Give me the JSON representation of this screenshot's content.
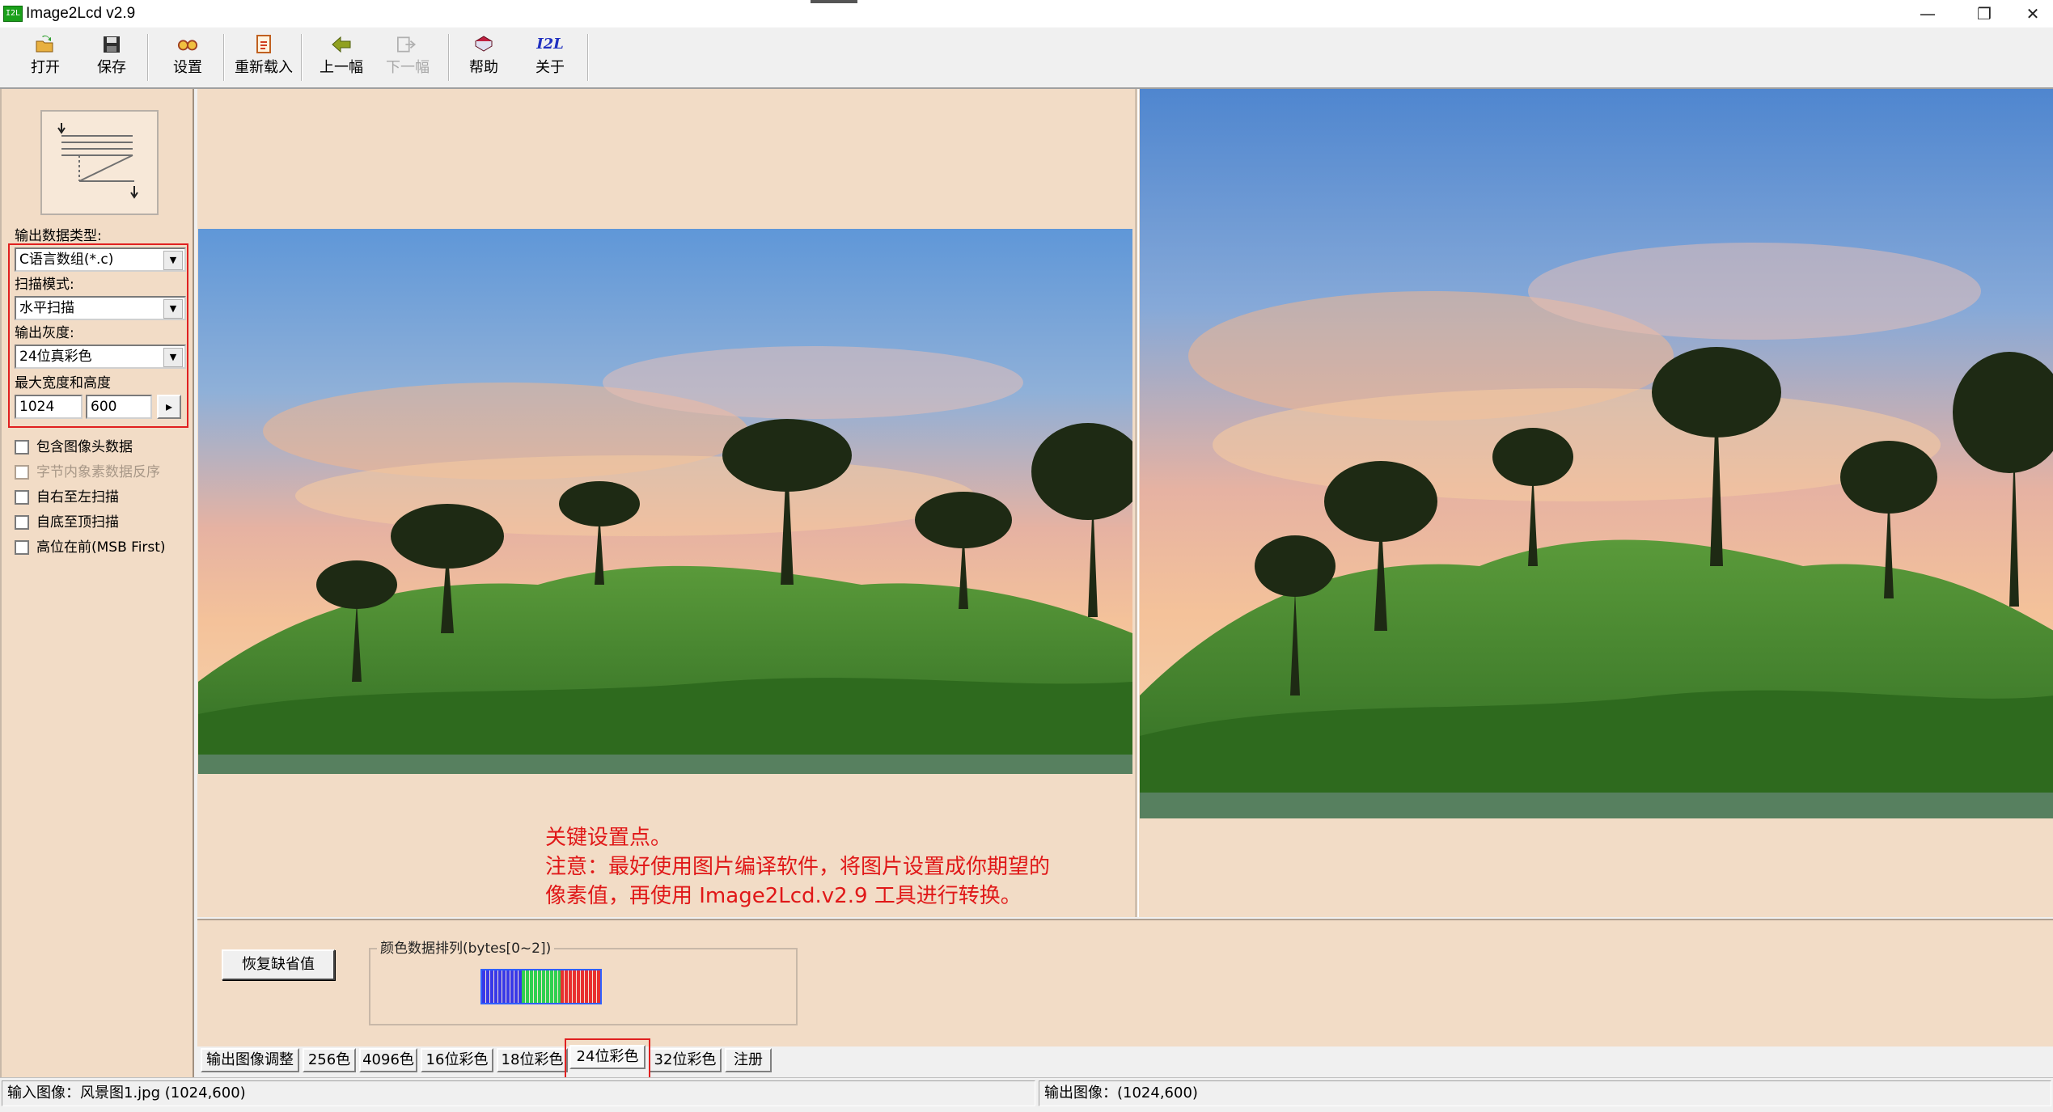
{
  "window": {
    "app_icon_text": "I2L",
    "title": "Image2Lcd v2.9",
    "minimize_glyph": "—",
    "restore_glyph": "❐",
    "close_glyph": "✕"
  },
  "toolbar": {
    "buttons": [
      {
        "label": "打开",
        "icon": "open-folder-icon",
        "enabled": true
      },
      {
        "label": "保存",
        "icon": "floppy-disk-icon",
        "enabled": true
      },
      {
        "label": "设置",
        "icon": "settings-glasses-icon",
        "enabled": true
      },
      {
        "label": "重新载入",
        "icon": "reload-document-icon",
        "enabled": true
      },
      {
        "label": "上一幅",
        "icon": "arrow-left-icon",
        "enabled": true
      },
      {
        "label": "下一幅",
        "icon": "arrow-right-icon",
        "enabled": false
      },
      {
        "label": "帮助",
        "icon": "help-book-icon",
        "enabled": true
      },
      {
        "label": "关于",
        "icon": "i2l-logo-icon",
        "enabled": true
      }
    ]
  },
  "settings": {
    "output_type": {
      "label": "输出数据类型:",
      "value": "C语言数组(*.c)"
    },
    "scan_mode": {
      "label": "扫描模式:",
      "value": "水平扫描"
    },
    "gray_level": {
      "label": "输出灰度:",
      "value": "24位真彩色"
    },
    "max_size": {
      "label": "最大宽度和高度",
      "width": "1024",
      "height": "600",
      "apply_glyph": "▸"
    },
    "checkboxes": [
      {
        "label": "包含图像头数据",
        "checked": false,
        "enabled": true
      },
      {
        "label": "字节内象素数据反序",
        "checked": false,
        "enabled": false
      },
      {
        "label": "自右至左扫描",
        "checked": false,
        "enabled": true
      },
      {
        "label": "自底至顶扫描",
        "checked": false,
        "enabled": true
      },
      {
        "label": "高位在前(MSB First)",
        "checked": false,
        "enabled": true
      }
    ]
  },
  "annotation": {
    "line1": "关键设置点。",
    "line2": "注意：最好使用图片编译软件，将图片设置成你期望的",
    "line3": "像素值，再使用 Image2Lcd.v2.9 工具进行转换。"
  },
  "adjust": {
    "restore_label": "恢复缺省值",
    "color_order_title": "颜色数据排列(bytes[0~2])",
    "color_order": [
      "blue",
      "green",
      "red"
    ],
    "colors": {
      "blue": "#3838e8",
      "green": "#30d050",
      "red": "#e83030"
    }
  },
  "tabs": [
    "输出图像调整",
    "256色",
    "4096色",
    "16位彩色",
    "18位彩色",
    "24位彩色",
    "32位彩色",
    "注册"
  ],
  "active_tab": "24位彩色",
  "status": {
    "input": "输入图像：风景图1.jpg (1024,600)",
    "output": "输出图像：(1024,600)"
  },
  "colors": {
    "panel_bg": "#f2dcc6",
    "highlight_red": "#e02020"
  }
}
